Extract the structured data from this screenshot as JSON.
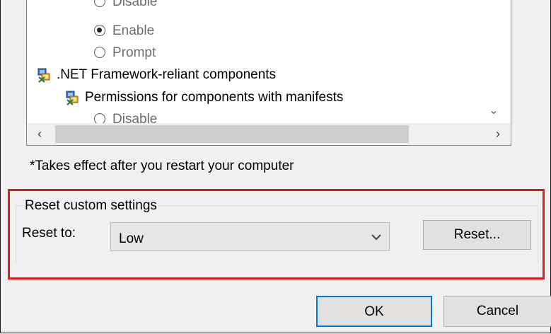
{
  "settings_list": {
    "rows": [
      {
        "type": "radio",
        "label": "Disable",
        "checked": false
      },
      {
        "type": "radio",
        "label": "Enable",
        "checked": true
      },
      {
        "type": "radio",
        "label": "Prompt",
        "checked": false
      },
      {
        "type": "category",
        "label": ".NET Framework-reliant components",
        "icon": "security-settings-icon"
      },
      {
        "type": "category",
        "label": "Permissions for components with manifests",
        "icon": "security-settings-icon"
      },
      {
        "type": "radio",
        "label": "Disable",
        "checked": false
      }
    ],
    "scroll_left_glyph": "‹",
    "scroll_right_glyph": "›",
    "scroll_down_glyph": "⌄"
  },
  "note": "*Takes effect after you restart your computer",
  "reset_group": {
    "title": "Reset custom settings",
    "reset_to_label": "Reset to:",
    "selected_level": "Low",
    "reset_button": "Reset..."
  },
  "dialog_buttons": {
    "ok": "OK",
    "cancel": "Cancel"
  },
  "colors": {
    "highlight": "#e0201e",
    "focus_border": "#0078d7"
  }
}
